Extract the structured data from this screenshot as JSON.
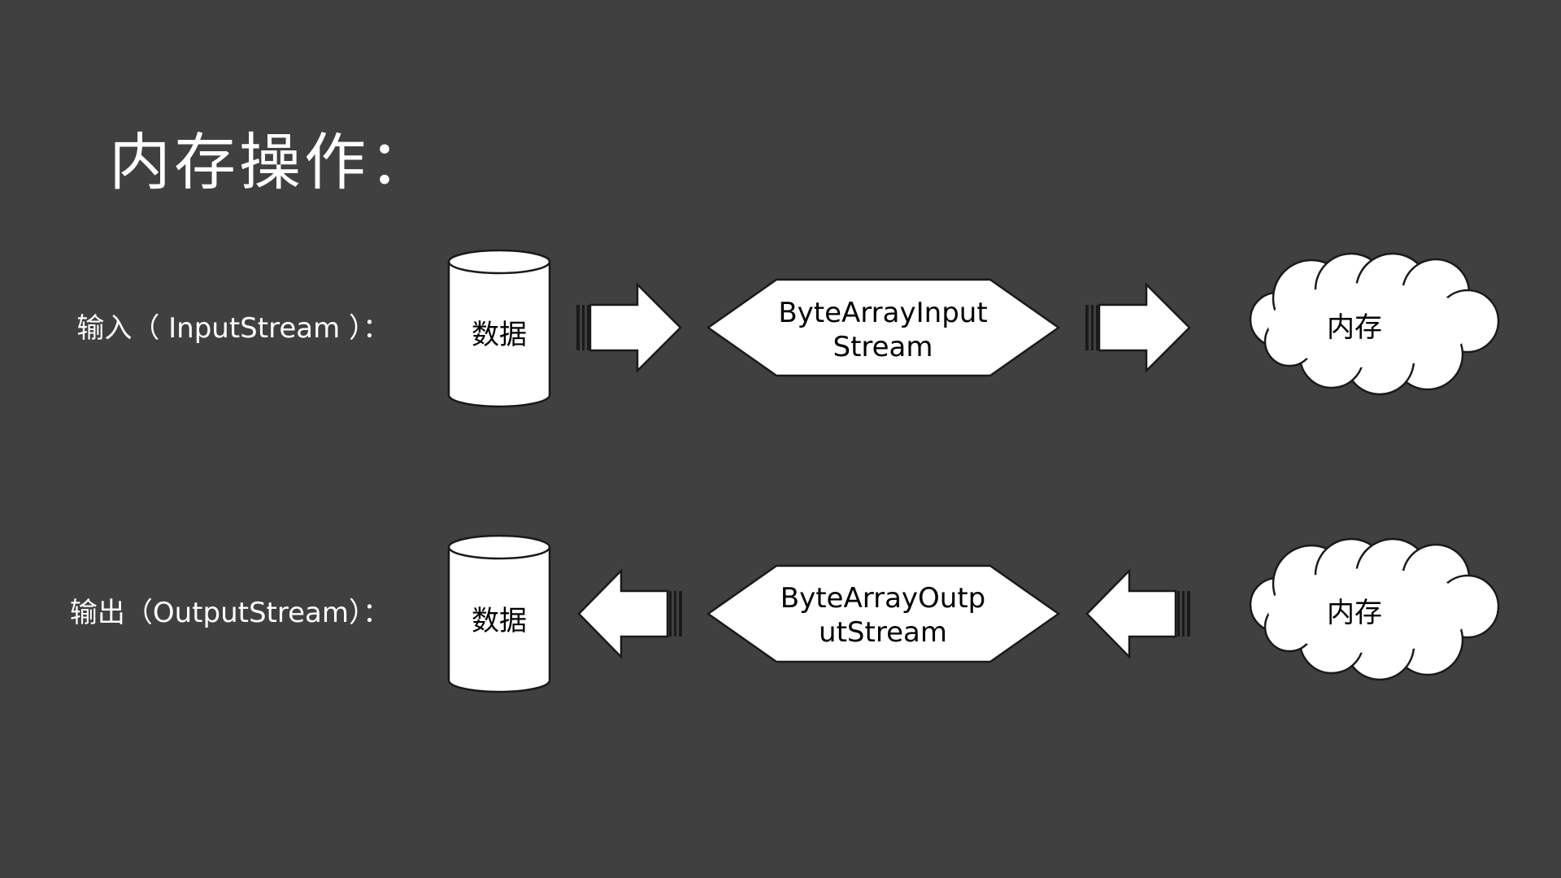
{
  "title": "内存操作：",
  "rows": [
    {
      "label": "输入（ InputStream ）：",
      "source": "数据",
      "stream_line1": "ByteArrayInput",
      "stream_line2": "Stream",
      "memory": "内存",
      "direction": "right"
    },
    {
      "label": "输出（OutputStream）：",
      "source": "数据",
      "stream_line1": "ByteArrayOutp",
      "stream_line2": "utStream",
      "memory": "内存",
      "direction": "left"
    }
  ],
  "colors": {
    "background": "#404040",
    "text": "#ffffff",
    "shape_fill": "#ffffff",
    "shape_stroke": "#1a1a1a"
  }
}
